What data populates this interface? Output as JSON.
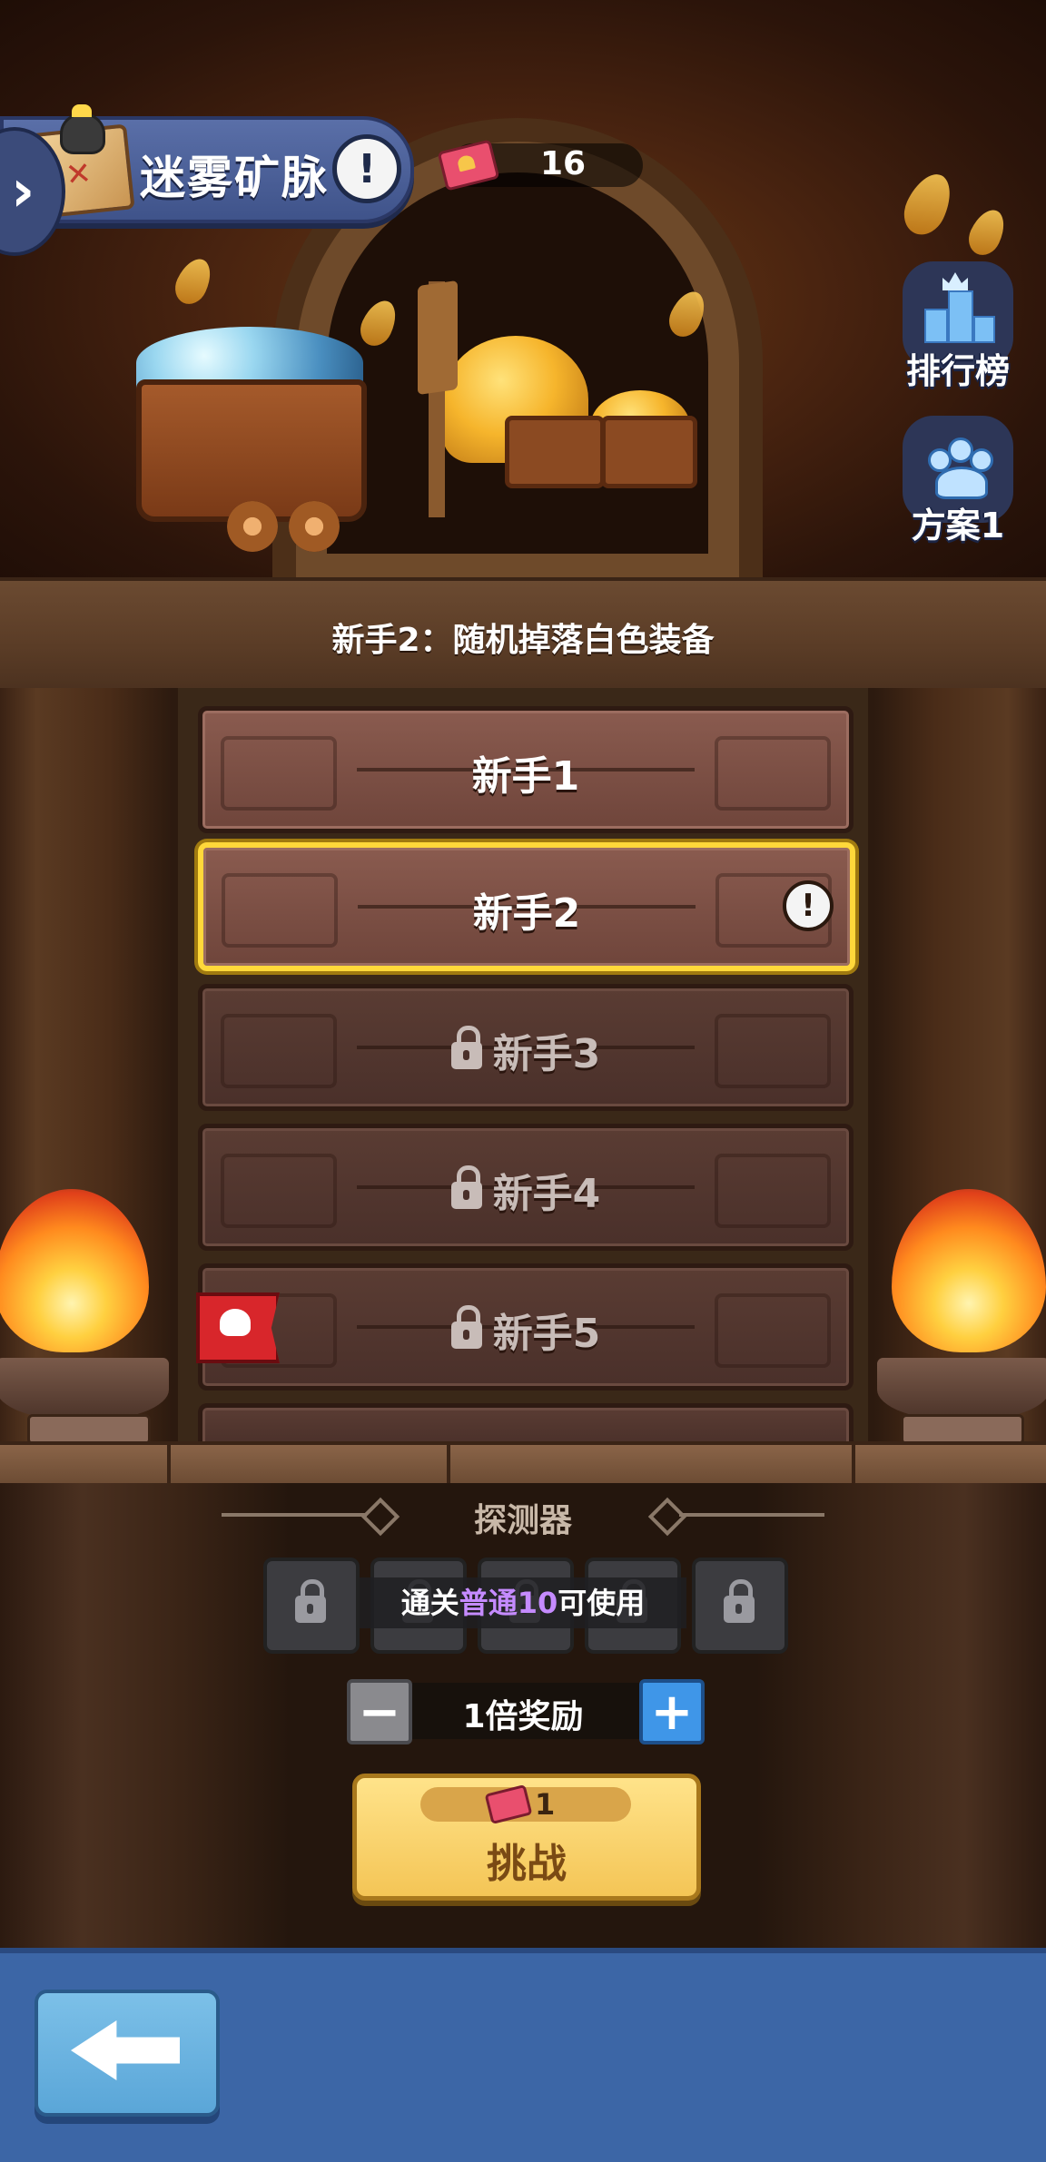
{
  "header": {
    "title": "迷雾矿脉",
    "info_symbol": "!",
    "side_toggle_symbol": "›",
    "ticket_count": "16"
  },
  "side_buttons": {
    "leaderboard_label": "排行榜",
    "plan_label": "方案1"
  },
  "stage_info": "新手2：随机掉落白色装备",
  "levels": [
    {
      "label": "新手1",
      "locked": false,
      "selected": false
    },
    {
      "label": "新手2",
      "locked": false,
      "selected": true,
      "badge": "!"
    },
    {
      "label": "新手3",
      "locked": true,
      "selected": false
    },
    {
      "label": "新手4",
      "locked": true,
      "selected": false
    },
    {
      "label": "新手5",
      "locked": true,
      "selected": false,
      "boss": true
    }
  ],
  "detector": {
    "title": "探测器",
    "unlock_prefix": "通关",
    "unlock_highlight": "普通10",
    "unlock_suffix": "可使用"
  },
  "multiplier": {
    "label": "1倍奖励",
    "minus": "−",
    "plus": "+"
  },
  "challenge": {
    "cost": "1",
    "label": "挑战"
  },
  "colors": {
    "selected_border": "#ffd83a",
    "highlight_text": "#c58bff",
    "footer": "#3c66a6",
    "plus_button": "#3f96e8"
  }
}
